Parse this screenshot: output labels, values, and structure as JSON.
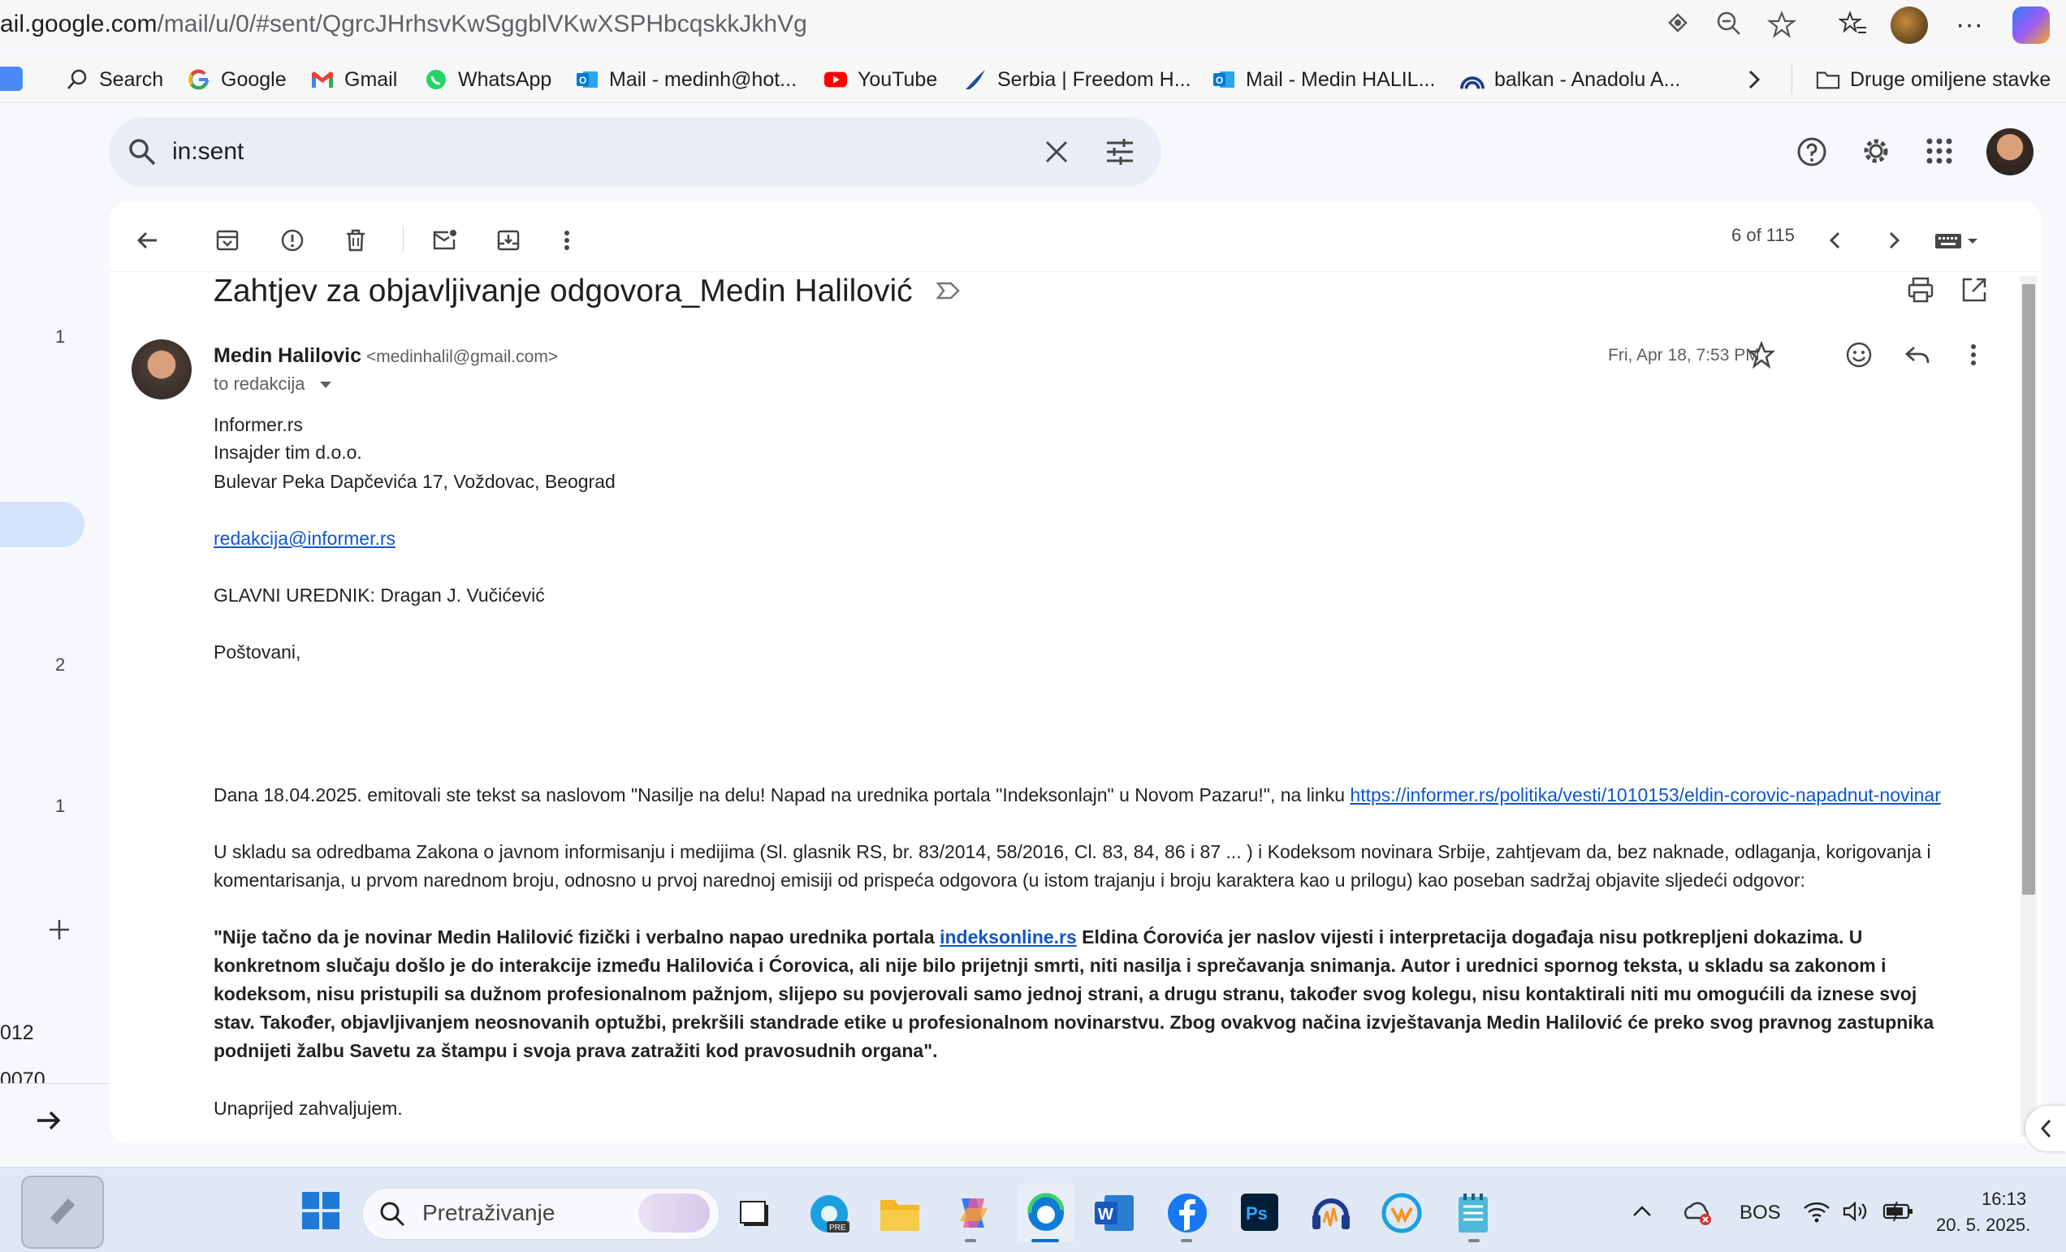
{
  "browser": {
    "url_host": "ail.google.com",
    "url_path": "/mail/u/0/#sent/QgrcJHrhsvKwSggblVKwXSPHbcqskkJkhVg",
    "bookmarks": [
      {
        "label": "Search",
        "icon": "search-icon"
      },
      {
        "label": "Google",
        "icon": "google-icon"
      },
      {
        "label": "Gmail",
        "icon": "gmail-icon"
      },
      {
        "label": "WhatsApp",
        "icon": "whatsapp-icon"
      },
      {
        "label": "Mail - medinh@hot...",
        "icon": "outlook-icon"
      },
      {
        "label": "YouTube",
        "icon": "youtube-icon"
      },
      {
        "label": "Serbia | Freedom H...",
        "icon": "freedom-house-icon"
      },
      {
        "label": "Mail - Medin HALIL...",
        "icon": "outlook-icon"
      },
      {
        "label": "balkan - Anadolu A...",
        "icon": "anadolu-icon"
      }
    ],
    "other_favorites": "Druge omiljene stavke"
  },
  "gmail": {
    "search_query": "in:sent",
    "pager": "6 of 115",
    "subject": "Zahtjev za objavljivanje odgovora_Medin Halilović",
    "sender_name": "Medin Halilovic",
    "sender_email": "<medinhalil@gmail.com>",
    "to": "to redakcija",
    "date": "Fri, Apr 18, 7:53 PM",
    "rail": {
      "counts": [
        "1",
        "2",
        "1"
      ],
      "text_a": "012",
      "text_b": "0070"
    },
    "body": {
      "addr1": "Informer.rs",
      "addr2": "Insajder tim d.o.o.",
      "addr3": "Bulevar Peka Dapčevića 17, Voždovac, Beograd",
      "email_link": "redakcija@informer.rs",
      "editor": "GLAVNI UREDNIK: Dragan J. Vučićević",
      "greeting": "Poštovani,",
      "p1_text": "Dana 18.04.2025. emitovali ste tekst sa naslovom \"Nasilje na delu! Napad na urednika portala \"Indeksonlajn\" u Novom Pazaru!\", na linku ",
      "p1_link": "https://informer.rs/politika/vesti/1010153/eldin-corovic-napadnut-novinar",
      "p2_l1": "U skladu sa odredbama Zakona o javnom informisanju i medijima (Sl. glasnik RS, br. 83/2014, 58/2016, Cl. 83, 84, 86 i 87 ... ) i Kodeksom novinara Srbije, zahtjevam da, bez naknade, odlaganja, korigovanja i",
      "p2_l2": "komentarisanja, u prvom narednom broju, odnosno u prvoj narednoj  emisiji od prispeća odgovora (u istom trajanju i broju karaktera kao u prilogu) kao poseban sadržaj objavite sljedeći odgovor:",
      "q_l1_a": "\"Nije tačno da je novinar Medin Halilović fizički i verbalno napao urednika portala ",
      "q_l1_link": "indeksonline.rs",
      "q_l1_b": " Eldina Ćorovića jer naslov vijesti i interpretacija događaja nisu potkrepljeni dokazima. U",
      "q_l2": "konkretnom slučaju došlo je do interakcije između Halilovića i Ćorovica, ali nije bilo prijetnji smrti, niti nasilja i sprečavanja snimanja. Autor i urednici spornog teksta, u skladu sa zakonom i",
      "q_l3": "kodeksom, nisu pristupili sa dužnom profesionalnom pažnjom, slijepo su povjerovali samo jednoj strani, a drugu stranu, također svog kolegu, nisu kontaktirali niti mu omogućili da iznese svoj",
      "q_l4": "stav. Također, objavljivanjem neosnovanih optužbi, prekršili standrade etike u profesionalnom novinarstvu. Zbog ovakvog načina izvještavanja Medin Halilović će preko svog pravnog zastupnika",
      "q_l5": "podnijeti žalbu Savetu za štampu i svoja prava zatražiti kod pravosudnih organa\".",
      "closing": "Unaprijed zahvaljujem."
    }
  },
  "taskbar": {
    "search_placeholder": "Pretraživanje",
    "language": "BOS",
    "time": "16:13",
    "date": "20. 5. 2025."
  }
}
